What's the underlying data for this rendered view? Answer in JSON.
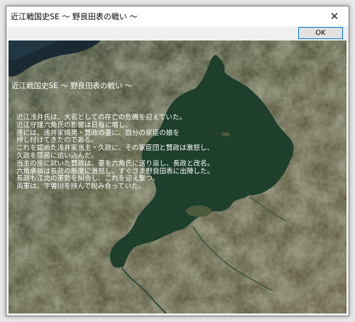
{
  "window": {
    "title": "近江戦国史SE 〜 野良田表の戦い 〜",
    "close_glyph": "✕"
  },
  "toolbar": {
    "ok_label": "OK"
  },
  "content": {
    "overlay_title": "近江戦国史SE 〜 野良田表の戦い 〜",
    "story": [
      "近江浅井氏は、大名としての存亡の危機を迎えていた。",
      "近江守護六角氏の影響は日毎に増し、",
      "遂には、浅井家嫡男・賢政の妻に、自分の家臣の娘を",
      "押し付けてきたのである。",
      "これを認めた浅井家当主・久政に、その家臣団と賢政は激怒し、",
      "久政を隠居に追い込んだ。",
      "当主の座に就いた賢政は、妻を六角氏に送り返し、長政と改名。",
      "六角承禎は長政の態度に激怒し、すぐさま野良田表に出陣した。",
      "長政も江北の軍勢を糾合し、これを迎え撃つ。",
      "両軍は、宇曽川を挟んで睨み合っていた。"
    ]
  },
  "colors": {
    "lake": "#1d3f2c",
    "terrain": "#55573f",
    "text": "#ffffff"
  }
}
